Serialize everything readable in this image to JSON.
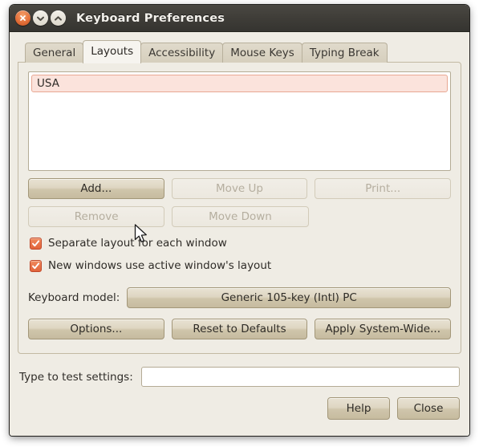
{
  "window": {
    "title": "Keyboard Preferences",
    "controls": [
      {
        "name": "close",
        "label": "×",
        "color": "#e4703a"
      },
      {
        "name": "minimize",
        "label": "▾",
        "color": "#e8e3d8"
      },
      {
        "name": "maximize",
        "label": "▴",
        "color": "#e8e3d8"
      }
    ]
  },
  "tabs": [
    {
      "label": "General",
      "active": false
    },
    {
      "label": "Layouts",
      "active": true
    },
    {
      "label": "Accessibility",
      "active": false
    },
    {
      "label": "Mouse Keys",
      "active": false
    },
    {
      "label": "Typing Break",
      "active": false
    }
  ],
  "layouts": {
    "items": [
      {
        "label": "USA",
        "selected": true
      }
    ],
    "selected_bg": "#fbe3dc",
    "selected_border": "#e8a893"
  },
  "list_buttons": {
    "row1": [
      {
        "label": "Add...",
        "state": "hover"
      },
      {
        "label": "Move Up",
        "state": "disabled"
      },
      {
        "label": "Print...",
        "state": "disabled"
      }
    ],
    "row2": [
      {
        "label": "Remove",
        "state": "disabled"
      },
      {
        "label": "Move Down",
        "state": "disabled"
      }
    ]
  },
  "checkboxes": [
    {
      "label": "Separate layout for each window",
      "checked": true
    },
    {
      "label": "New windows use active window's layout",
      "checked": true
    }
  ],
  "keyboard_model": {
    "label": "Keyboard model:",
    "value": "Generic 105-key (Intl) PC"
  },
  "option_buttons": [
    {
      "label": "Options..."
    },
    {
      "label": "Reset to Defaults"
    },
    {
      "label": "Apply System-Wide..."
    }
  ],
  "test_settings": {
    "label": "Type to test settings:",
    "value": "",
    "placeholder": ""
  },
  "action_buttons": [
    {
      "label": "Help"
    },
    {
      "label": "Close"
    }
  ],
  "theme": {
    "titlebar": "#403e39",
    "window_bg": "#efece4",
    "accent": "#e2633a",
    "text": "#2f2c28",
    "disabled_text": "#b5ae9f"
  }
}
